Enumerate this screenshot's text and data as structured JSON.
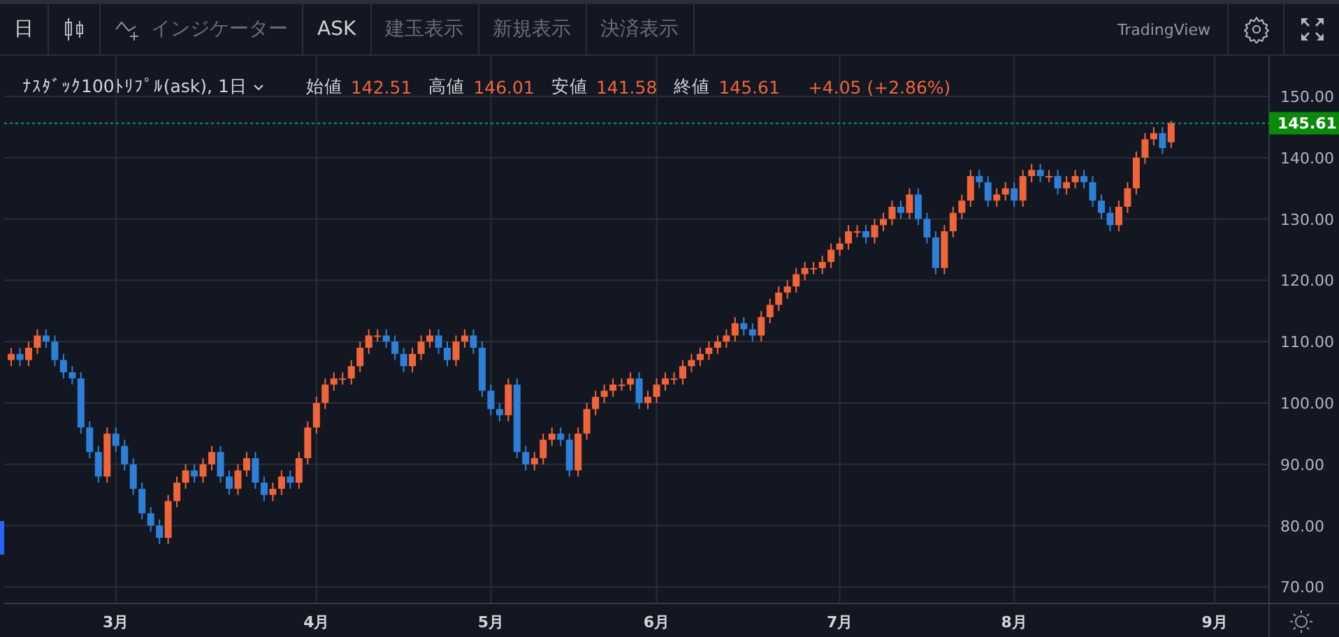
{
  "toolbar": {
    "interval": "日",
    "indicators_label": "インジケーター",
    "toggles": [
      {
        "label": "ASK",
        "active": true
      },
      {
        "label": "建玉表示",
        "active": false
      },
      {
        "label": "新規表示",
        "active": false
      },
      {
        "label": "決済表示",
        "active": false
      }
    ],
    "brand": "TradingView"
  },
  "legend": {
    "symbol": "ﾅｽﾀﾞｯｸ100ﾄﾘﾌﾟﾙ(ask), 1日",
    "fields": [
      {
        "label": "始値",
        "value": "142.51"
      },
      {
        "label": "高値",
        "value": "146.01"
      },
      {
        "label": "安値",
        "value": "141.58"
      },
      {
        "label": "終値",
        "value": "145.61"
      }
    ],
    "change": "+4.05 (+2.86%)"
  },
  "chart": {
    "chart_data": {
      "type": "candlestick",
      "grid": true,
      "ylim": [
        67.3,
        156.6
      ],
      "yticks": [
        {
          "value": 70,
          "label": "70.00"
        },
        {
          "value": 80,
          "label": "80.00"
        },
        {
          "value": 90,
          "label": "90.00"
        },
        {
          "value": 100,
          "label": "100.00"
        },
        {
          "value": 110,
          "label": "110.00"
        },
        {
          "value": 120,
          "label": "120.00"
        },
        {
          "value": 130,
          "label": "130.00"
        },
        {
          "value": 140,
          "label": "140.00"
        },
        {
          "value": 150,
          "label": "150.00"
        }
      ],
      "ref_lines": [
        {
          "axis": "y",
          "value": 145.61,
          "label": "145.61"
        }
      ],
      "categories": [
        null,
        null,
        null,
        null,
        null,
        null,
        null,
        null,
        null,
        null,
        null,
        null,
        "3月",
        null,
        null,
        null,
        null,
        null,
        null,
        null,
        null,
        null,
        null,
        null,
        null,
        null,
        null,
        null,
        null,
        null,
        null,
        null,
        null,
        null,
        null,
        "4月",
        null,
        null,
        null,
        null,
        null,
        null,
        null,
        null,
        null,
        null,
        null,
        null,
        null,
        null,
        null,
        null,
        null,
        null,
        null,
        "5月",
        null,
        null,
        null,
        null,
        null,
        null,
        null,
        null,
        null,
        null,
        null,
        null,
        null,
        null,
        null,
        null,
        null,
        null,
        "6月",
        null,
        null,
        null,
        null,
        null,
        null,
        null,
        null,
        null,
        null,
        null,
        null,
        null,
        null,
        null,
        null,
        null,
        null,
        null,
        null,
        "7月",
        null,
        null,
        null,
        null,
        null,
        null,
        null,
        null,
        null,
        null,
        null,
        null,
        null,
        null,
        null,
        null,
        null,
        null,
        null,
        "8月",
        null,
        null,
        null,
        null,
        null,
        null,
        null,
        null,
        null,
        null,
        null,
        null,
        null,
        null,
        null,
        null,
        null,
        null,
        null,
        null,
        null,
        null,
        "9月"
      ],
      "ohlc": [
        [
          107,
          109,
          106,
          108
        ],
        [
          108,
          109,
          106,
          107
        ],
        [
          107,
          110,
          106,
          109
        ],
        [
          109,
          112,
          108,
          111
        ],
        [
          111,
          112,
          109,
          110
        ],
        [
          110,
          111,
          106,
          107
        ],
        [
          107,
          108,
          104,
          105
        ],
        [
          105,
          106,
          103,
          104
        ],
        [
          104,
          105,
          95,
          96
        ],
        [
          96,
          97,
          91,
          92
        ],
        [
          92,
          93,
          87,
          88
        ],
        [
          88,
          96,
          87,
          95
        ],
        [
          95,
          96,
          92,
          93
        ],
        [
          93,
          94,
          89,
          90
        ],
        [
          90,
          91,
          85,
          86
        ],
        [
          86,
          87,
          81,
          82
        ],
        [
          82,
          83,
          79,
          80
        ],
        [
          80,
          81,
          77,
          78
        ],
        [
          78,
          85,
          77,
          84
        ],
        [
          84,
          88,
          83,
          87
        ],
        [
          87,
          90,
          86,
          89
        ],
        [
          89,
          90,
          87,
          88
        ],
        [
          88,
          91,
          87,
          90
        ],
        [
          90,
          93,
          89,
          92
        ],
        [
          92,
          93,
          87,
          88
        ],
        [
          88,
          89,
          85,
          86
        ],
        [
          86,
          90,
          85,
          89
        ],
        [
          89,
          92,
          88,
          91
        ],
        [
          91,
          92,
          86,
          87
        ],
        [
          87,
          88,
          84,
          85
        ],
        [
          85,
          87,
          84,
          86
        ],
        [
          86,
          89,
          85,
          88
        ],
        [
          88,
          89,
          86,
          87
        ],
        [
          87,
          92,
          86,
          91
        ],
        [
          91,
          97,
          90,
          96
        ],
        [
          96,
          101,
          95,
          100
        ],
        [
          100,
          104,
          99,
          103
        ],
        [
          103,
          105,
          102,
          104
        ],
        [
          104,
          105,
          103,
          104
        ],
        [
          104,
          107,
          103,
          106
        ],
        [
          106,
          110,
          105,
          109
        ],
        [
          109,
          112,
          108,
          111
        ],
        [
          111,
          112,
          110,
          111
        ],
        [
          111,
          112,
          109,
          110
        ],
        [
          110,
          111,
          107,
          108
        ],
        [
          108,
          109,
          105,
          106
        ],
        [
          106,
          109,
          105,
          108
        ],
        [
          108,
          111,
          107,
          110
        ],
        [
          110,
          112,
          109,
          111
        ],
        [
          111,
          112,
          108,
          109
        ],
        [
          109,
          110,
          106,
          107
        ],
        [
          107,
          111,
          106,
          110
        ],
        [
          110,
          112,
          109,
          111
        ],
        [
          111,
          112,
          108,
          109
        ],
        [
          109,
          110,
          101,
          102
        ],
        [
          102,
          103,
          98,
          99
        ],
        [
          99,
          100,
          97,
          98
        ],
        [
          98,
          104,
          97,
          103
        ],
        [
          103,
          104,
          91,
          92
        ],
        [
          92,
          93,
          89,
          90
        ],
        [
          90,
          92,
          89,
          91
        ],
        [
          91,
          95,
          90,
          94
        ],
        [
          94,
          96,
          93,
          95
        ],
        [
          95,
          96,
          93,
          94
        ],
        [
          94,
          95,
          88,
          89
        ],
        [
          89,
          96,
          88,
          95
        ],
        [
          95,
          100,
          94,
          99
        ],
        [
          99,
          102,
          98,
          101
        ],
        [
          101,
          103,
          100,
          102
        ],
        [
          102,
          104,
          101,
          103
        ],
        [
          103,
          104,
          102,
          103
        ],
        [
          103,
          105,
          102,
          104
        ],
        [
          104,
          105,
          99,
          100
        ],
        [
          100,
          102,
          99,
          101
        ],
        [
          101,
          104,
          100,
          103
        ],
        [
          103,
          105,
          102,
          104
        ],
        [
          104,
          105,
          103,
          104
        ],
        [
          104,
          107,
          103,
          106
        ],
        [
          106,
          108,
          105,
          107
        ],
        [
          107,
          109,
          106,
          108
        ],
        [
          108,
          110,
          107,
          109
        ],
        [
          109,
          111,
          108,
          110
        ],
        [
          110,
          112,
          109,
          111
        ],
        [
          111,
          114,
          110,
          113
        ],
        [
          113,
          114,
          111,
          112
        ],
        [
          112,
          113,
          110,
          111
        ],
        [
          111,
          115,
          110,
          114
        ],
        [
          114,
          117,
          113,
          116
        ],
        [
          116,
          119,
          115,
          118
        ],
        [
          118,
          120,
          117,
          119
        ],
        [
          119,
          122,
          118,
          121
        ],
        [
          121,
          123,
          120,
          122
        ],
        [
          122,
          123,
          121,
          122
        ],
        [
          122,
          124,
          121,
          123
        ],
        [
          123,
          126,
          122,
          125
        ],
        [
          125,
          127,
          124,
          126
        ],
        [
          126,
          129,
          125,
          128
        ],
        [
          128,
          129,
          127,
          128
        ],
        [
          128,
          129,
          126,
          127
        ],
        [
          127,
          130,
          126,
          129
        ],
        [
          129,
          131,
          128,
          130
        ],
        [
          130,
          133,
          129,
          132
        ],
        [
          132,
          133,
          130,
          131
        ],
        [
          131,
          135,
          130,
          134
        ],
        [
          134,
          135,
          129,
          130
        ],
        [
          130,
          131,
          126,
          127
        ],
        [
          127,
          128,
          121,
          122
        ],
        [
          122,
          129,
          121,
          128
        ],
        [
          128,
          132,
          127,
          131
        ],
        [
          131,
          134,
          130,
          133
        ],
        [
          133,
          138,
          132,
          137
        ],
        [
          137,
          138,
          135,
          136
        ],
        [
          136,
          137,
          132,
          133
        ],
        [
          133,
          135,
          132,
          134
        ],
        [
          134,
          136,
          133,
          135
        ],
        [
          135,
          136,
          132,
          133
        ],
        [
          133,
          138,
          132,
          137
        ],
        [
          137,
          139,
          136,
          138
        ],
        [
          138,
          139,
          136,
          137
        ],
        [
          137,
          138,
          136,
          137
        ],
        [
          137,
          138,
          134,
          135
        ],
        [
          135,
          137,
          134,
          136
        ],
        [
          136,
          138,
          135,
          137
        ],
        [
          137,
          138,
          135,
          136
        ],
        [
          136,
          137,
          132,
          133
        ],
        [
          133,
          134,
          130,
          131
        ],
        [
          131,
          132,
          128,
          129
        ],
        [
          129,
          133,
          128,
          132
        ],
        [
          132,
          136,
          131,
          135
        ],
        [
          135,
          141,
          134,
          140
        ],
        [
          140,
          144,
          139,
          143
        ],
        [
          143,
          145,
          142,
          144
        ],
        [
          144,
          145,
          140.6,
          141.56
        ],
        [
          142.51,
          146.01,
          141.58,
          145.61
        ],
        null,
        null,
        null,
        null,
        null
      ]
    }
  }
}
